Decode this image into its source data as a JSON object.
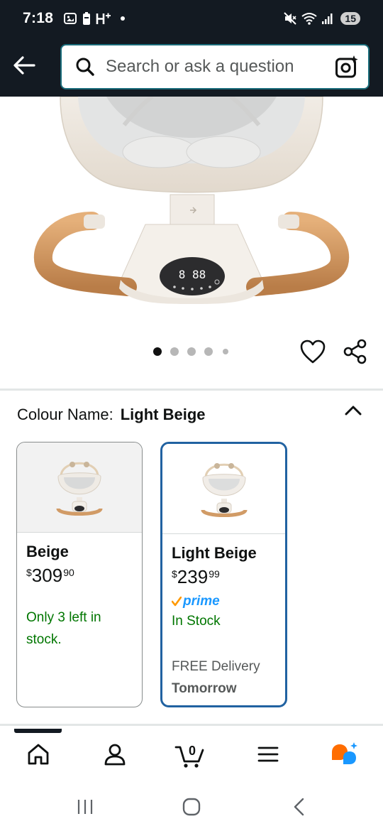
{
  "status_bar": {
    "time": "7:18",
    "battery": "15",
    "icons": [
      "gallery-icon",
      "battery-saver-icon",
      "h-plus-icon",
      "mute-icon",
      "wifi-icon",
      "signal-icon"
    ]
  },
  "search": {
    "placeholder": "Search or ask a question",
    "icons": [
      "back-arrow-icon",
      "search-icon",
      "camera-search-icon"
    ]
  },
  "carousel": {
    "total_images": 5,
    "active_index": 0,
    "actions": [
      "heart-icon",
      "share-icon"
    ]
  },
  "colour": {
    "label": "Colour Name:",
    "selected": "Light Beige",
    "variants": [
      {
        "name": "Beige",
        "currency": "$",
        "price_whole": "309",
        "price_fraction": "90",
        "stock": "Only 3 left in stock.",
        "selected": false
      },
      {
        "name": "Light Beige",
        "currency": "$",
        "price_whole": "239",
        "price_fraction": "99",
        "prime": "prime",
        "stock": "In Stock",
        "delivery": "FREE Delivery",
        "delivery_day": "Tomorrow",
        "selected": true
      }
    ]
  },
  "bottom_nav": {
    "items": [
      "home-icon",
      "account-icon",
      "cart-icon",
      "menu-icon",
      "rufus-icon"
    ],
    "cart_count": "0"
  },
  "colors": {
    "header_bg": "#131a22",
    "selected_border": "#2162a1",
    "stock_green": "#007600",
    "prime_blue": "#1a98ff",
    "prime_check": "#ff9900",
    "rufus_orange": "#ff6d00",
    "rufus_blue": "#1a98ff"
  }
}
